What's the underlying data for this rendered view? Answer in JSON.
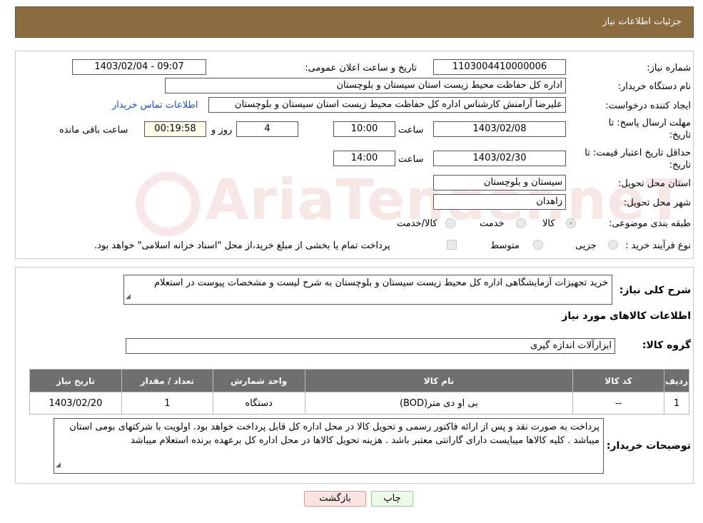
{
  "header": {
    "title": "جزئیات اطلاعات نیاز"
  },
  "form": {
    "need_number_label": "شماره نیاز:",
    "need_number": "1103004410000006",
    "announce_label": "تاریخ و ساعت اعلان عمومی:",
    "announce_value": "1403/02/04 - 09:07",
    "buyer_org_label": "نام دستگاه خریدار:",
    "buyer_org": "اداره کل حفاظت محیط زیست استان سیستان و بلوچستان",
    "creator_label": "ایجاد کننده درخواست:",
    "creator": "علیرضا آرامنش کارشناس اداره کل حفاظت محیط زیست استان سیستان و بلوچستان",
    "contact_link": "اطلاعات تماس خریدار",
    "deadline_label_1": "مهلت ارسال پاسخ: تا",
    "deadline_label_2": "تاریخ:",
    "deadline_date": "1403/02/08",
    "time_label": "ساعت",
    "deadline_time": "10:00",
    "days_value": "4",
    "days_label": "روز و",
    "remaining_time": "00:19:58",
    "remaining_label": "ساعت باقی مانده",
    "validity_label_1": "حداقل تاریخ اعتبار قیمت: تا",
    "validity_label_2": "تاریخ:",
    "validity_date": "1403/02/30",
    "validity_time": "14:00",
    "province_label": "استان محل تحویل:",
    "province": "سیستان و بلوچستان",
    "city_label": "شهر محل تحویل:",
    "city": "زاهدان",
    "category_label": "طبقه بندی موضوعی:",
    "category_options": [
      "کالا",
      "خدمت",
      "کالا/خدمت"
    ],
    "process_label": "نوع فرآیند خرید :",
    "process_options": [
      "جزیی",
      "متوسط"
    ],
    "payment_note": "پرداخت تمام یا بخشی از مبلغ خرید،از محل \"اسناد خزانه اسلامی\" خواهد بود."
  },
  "watermark": {
    "text": "AriaTender.neT"
  },
  "summary": {
    "label": "شرح کلی نیاز:",
    "text": "خرید تجهیزات آزمایشگاهی اداره کل محیط زیست سیستان و بلوچستان به شرح لیست و مشخصات پیوست در استعلام",
    "goods_info_title": "اطلاعات کالاهای مورد نیاز",
    "group_label": "گروه کالا:",
    "group_value": "ابزارآلات اندازه گیری"
  },
  "table": {
    "headers": [
      "ردیف",
      "کد کالا",
      "نام کالا",
      "واحد شمارش",
      "تعداد / مقدار",
      "تاریخ نیاز"
    ],
    "rows": [
      [
        "1",
        "--",
        "بی او دی متر(BOD)",
        "دستگاه",
        "1",
        "1403/02/20"
      ]
    ]
  },
  "buyer_notes": {
    "label": "توضیحات خریدار:",
    "text": "پرداخت به صورت نقد و پس از ارائه فاکتور رسمی و تحویل کالا در محل اداره کل قابل پرداخت خواهد بود. اولویت با شرکتهای بومی استان میباشد . کلیه کالاها میبایست دارای گارانتی معتبر باشد . هزینه تحویل کالاها در محل اداره کل برعهده برنده استعلام میباشد"
  },
  "buttons": {
    "print": "چاپ",
    "back": "بازگشت"
  }
}
